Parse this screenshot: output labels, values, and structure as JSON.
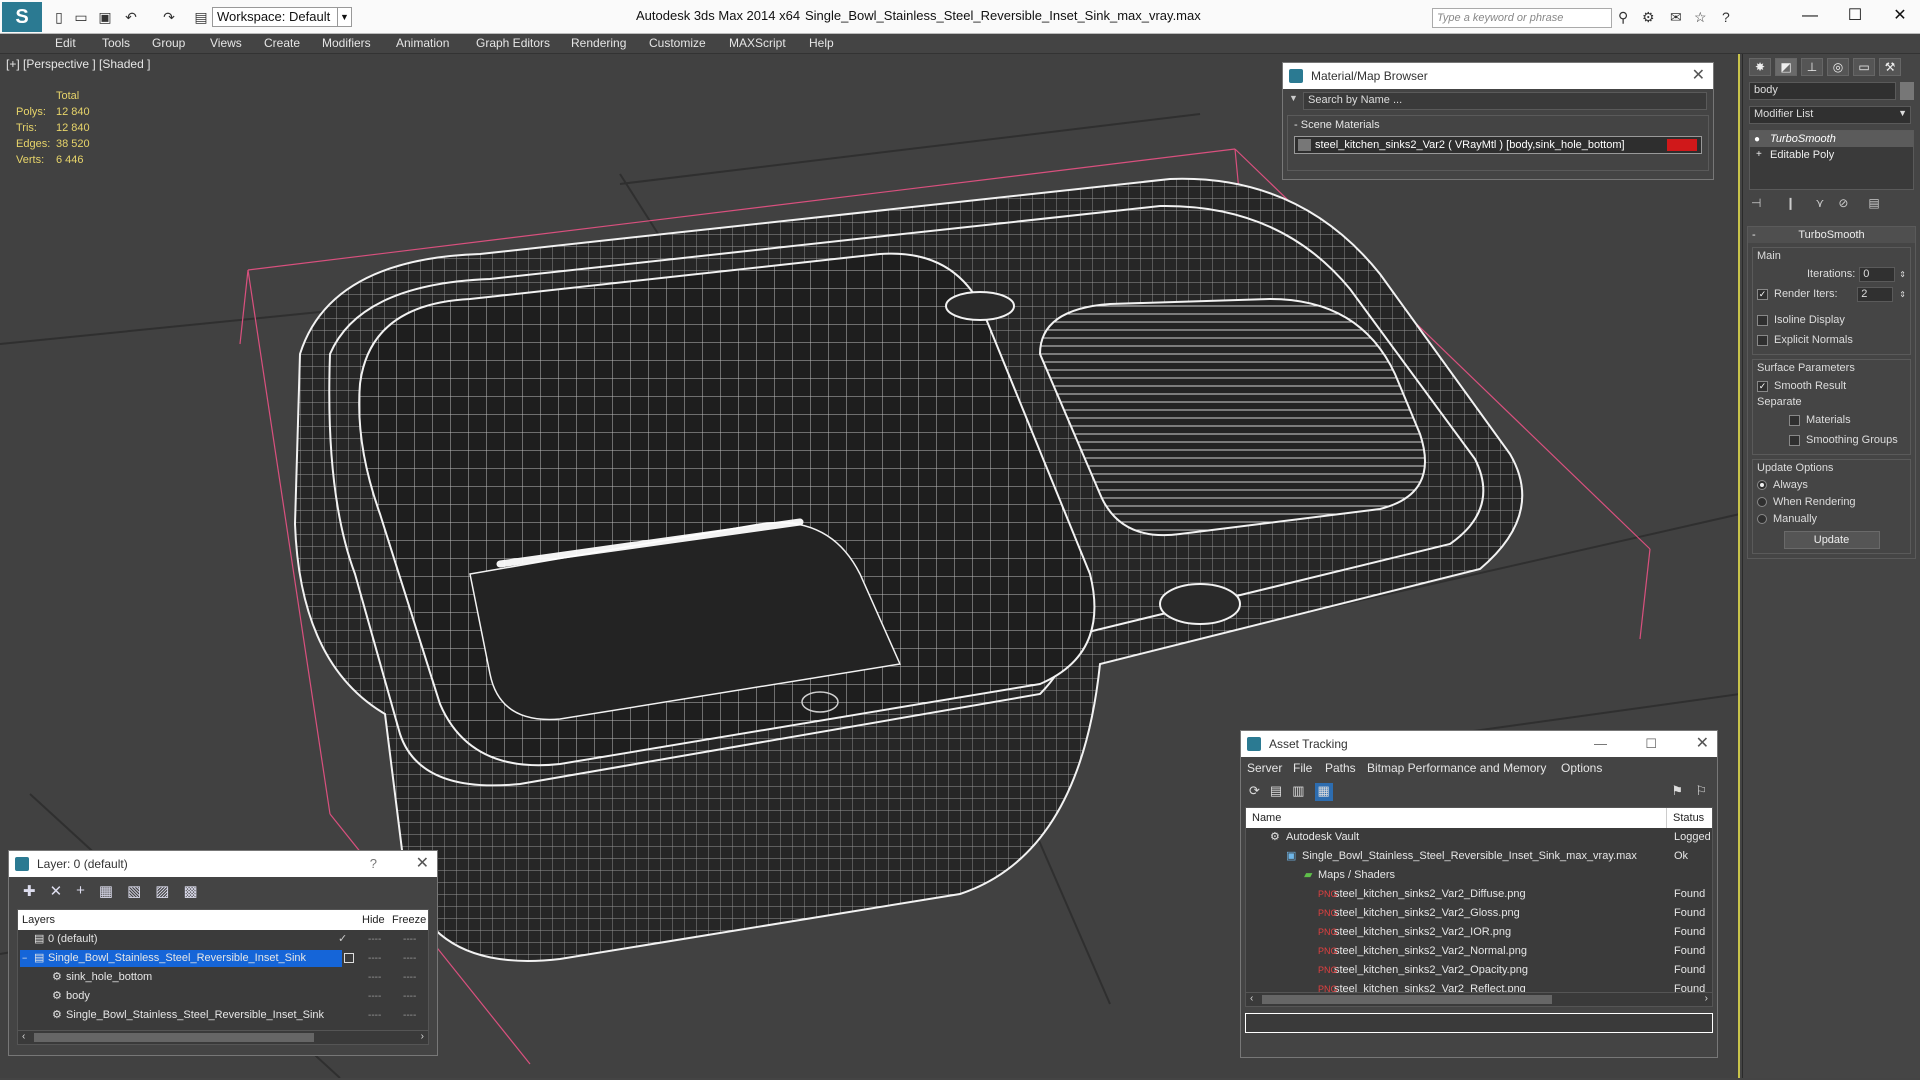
{
  "window": {
    "app_title": "Autodesk 3ds Max  2014 x64",
    "file_title": "Single_Bowl_Stainless_Steel_Reversible_Inset_Sink_max_vray.max",
    "workspace": "Workspace: Default",
    "search_placeholder": "Type a keyword or phrase",
    "minimize": "—",
    "maximize": "☐",
    "close": "✕"
  },
  "menu": [
    "Edit",
    "Tools",
    "Group",
    "Views",
    "Create",
    "Modifiers",
    "Animation",
    "Graph Editors",
    "Rendering",
    "Customize",
    "MAXScript",
    "Help"
  ],
  "viewport": {
    "label": "[+] [Perspective ] [Shaded ]",
    "stats": {
      "header": "Total",
      "rows": [
        {
          "k": "Polys:",
          "v": "12 840"
        },
        {
          "k": "Tris:",
          "v": "12 840"
        },
        {
          "k": "Edges:",
          "v": "38 520"
        },
        {
          "k": "Verts:",
          "v": "6 446"
        }
      ]
    }
  },
  "material_browser": {
    "title": "Material/Map Browser",
    "search_placeholder": "Search by Name ...",
    "section": "Scene Materials",
    "item": "steel_kitchen_sinks2_Var2  ( VRayMtl )  [body,sink_hole_bottom]",
    "close": "✕"
  },
  "command_panel": {
    "object_name": "body",
    "modifier_list": "Modifier List",
    "stack": [
      "TurboSmooth",
      "Editable Poly"
    ],
    "rollup_title": "TurboSmooth",
    "main_label": "Main",
    "iterations_label": "Iterations:",
    "iterations_value": "0",
    "render_iters_label": "Render Iters:",
    "render_iters_value": "2",
    "isoline": "Isoline Display",
    "explicit_normals": "Explicit Normals",
    "surface_params": "Surface Parameters",
    "smooth_result": "Smooth Result",
    "separate": "Separate",
    "materials": "Materials",
    "smoothing_groups": "Smoothing Groups",
    "update_options": "Update Options",
    "always": "Always",
    "when_rendering": "When Rendering",
    "manually": "Manually",
    "update_button": "Update"
  },
  "layer_panel": {
    "title": "Layer: 0 (default)",
    "help": "?",
    "close": "✕",
    "col_layers": "Layers",
    "col_hide": "Hide",
    "col_freeze": "Freeze",
    "rows": [
      {
        "name": "0 (default)"
      },
      {
        "name": "Single_Bowl_Stainless_Steel_Reversible_Inset_Sink"
      },
      {
        "name": "sink_hole_bottom"
      },
      {
        "name": "body"
      },
      {
        "name": "Single_Bowl_Stainless_Steel_Reversible_Inset_Sink"
      }
    ]
  },
  "asset_tracking": {
    "title": "Asset Tracking",
    "menu": [
      "Server",
      "File",
      "Paths",
      "Bitmap Performance and Memory",
      "Options"
    ],
    "col_name": "Name",
    "col_status": "Status",
    "rows": [
      {
        "name": "Autodesk Vault",
        "status": "Logged Out"
      },
      {
        "name": "Single_Bowl_Stainless_Steel_Reversible_Inset_Sink_max_vray.max",
        "status": "Ok"
      },
      {
        "name": "Maps / Shaders",
        "status": ""
      },
      {
        "name": "steel_kitchen_sinks2_Var2_Diffuse.png",
        "status": "Found"
      },
      {
        "name": "steel_kitchen_sinks2_Var2_Gloss.png",
        "status": "Found"
      },
      {
        "name": "steel_kitchen_sinks2_Var2_IOR.png",
        "status": "Found"
      },
      {
        "name": "steel_kitchen_sinks2_Var2_Normal.png",
        "status": "Found"
      },
      {
        "name": "steel_kitchen_sinks2_Var2_Opacity.png",
        "status": "Found"
      },
      {
        "name": "steel_kitchen_sinks2_Var2_Reflect.png",
        "status": "Found"
      }
    ],
    "minimize": "—",
    "maximize": "☐",
    "close": "✕"
  }
}
